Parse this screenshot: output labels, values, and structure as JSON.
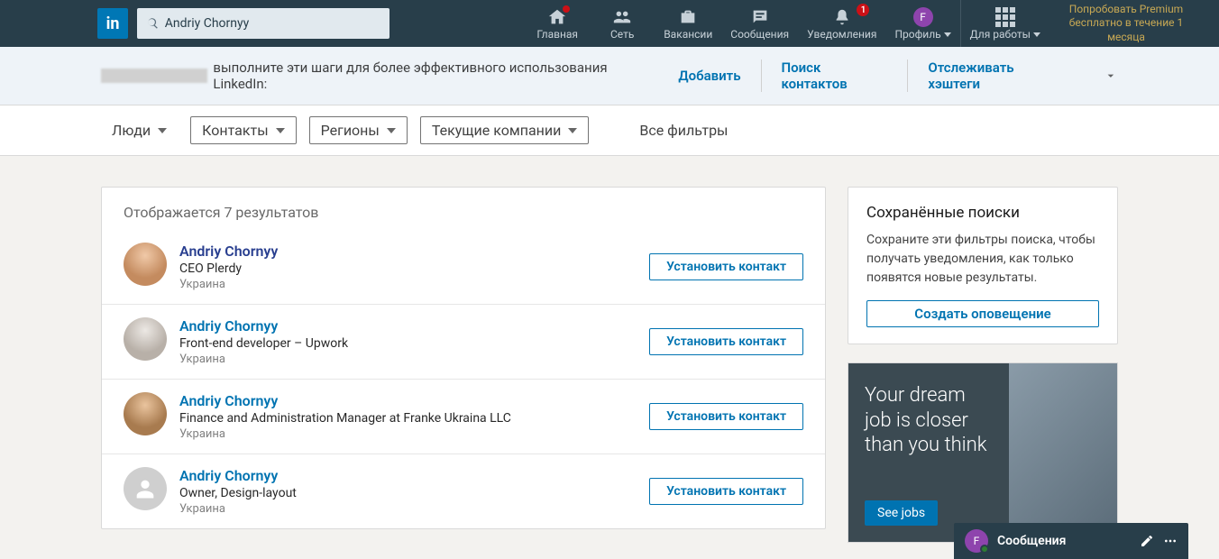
{
  "header": {
    "search_value": "Andriy Chornyy",
    "nav": [
      {
        "label": "Главная",
        "id": "home"
      },
      {
        "label": "Сеть",
        "id": "network"
      },
      {
        "label": "Вакансии",
        "id": "jobs"
      },
      {
        "label": "Сообщения",
        "id": "messaging"
      },
      {
        "label": "Уведомления",
        "id": "notifications",
        "badge": "1"
      },
      {
        "label": "Профиль",
        "id": "me"
      }
    ],
    "home_dot": true,
    "work_label": "Для работы",
    "premium": "Попробовать Premium бесплатно в течение 1 месяца",
    "avatar_letter": "F"
  },
  "banner": {
    "text": "выполните эти шаги для более эффективного использования LinkedIn:",
    "links": [
      "Добавить",
      "Поиск контактов",
      "Отслеживать хэштеги"
    ]
  },
  "filters": {
    "primary": "Люди",
    "pills": [
      "Контакты",
      "Регионы",
      "Текущие компании"
    ],
    "all": "Все фильтры"
  },
  "results": {
    "heading": "Отображается 7 результатов",
    "connect_label": "Установить контакт",
    "items": [
      {
        "name": "Andriy Chornyy",
        "headline": "CEO Plerdy",
        "loc": "Украина",
        "purple": true,
        "ava": "a1"
      },
      {
        "name": "Andriy Chornyy",
        "headline": "Front-end developer – Upwork",
        "loc": "Украина",
        "ava": "a2"
      },
      {
        "name": "Andriy Chornyy",
        "headline": "Finance and Administration Manager at Franke Ukraina LLC",
        "loc": "Украина",
        "ava": "a3"
      },
      {
        "name": "Andriy Chornyy",
        "headline": "Owner, Design-layout",
        "loc": "Украина",
        "ava": "a4",
        "ghost": true
      }
    ]
  },
  "sidebar": {
    "saved_title": "Сохранённые поиски",
    "saved_desc": "Сохраните эти фильтры поиска, чтобы получать уведомления, как только появятся новые результаты.",
    "create_alert": "Создать оповещение",
    "ad_text": "Your dream job is closer than you think",
    "ad_cta": "See jobs"
  },
  "messaging": {
    "title": "Сообщения",
    "avatar_letter": "F"
  }
}
